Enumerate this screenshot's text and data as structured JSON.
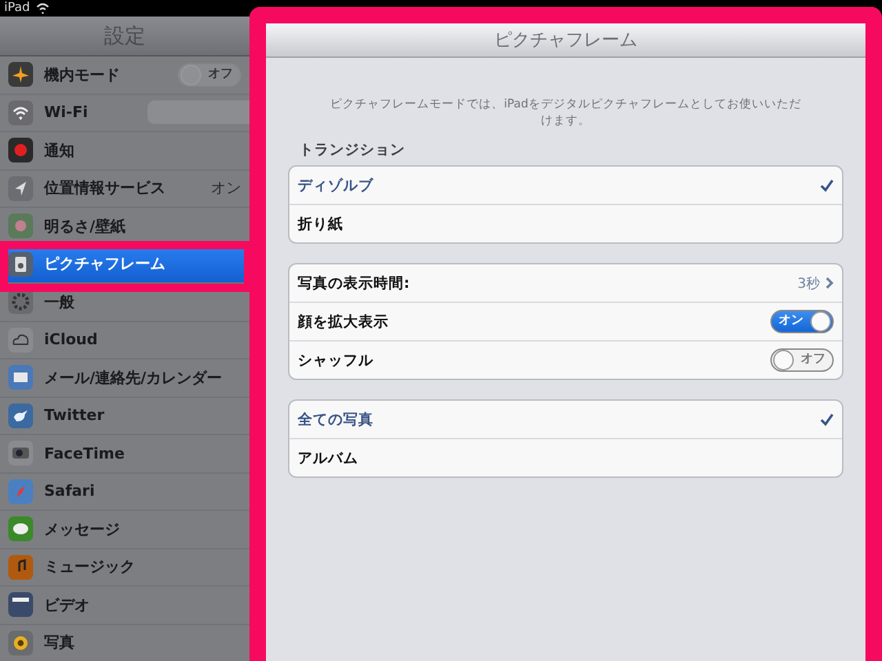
{
  "status_bar": {
    "device": "iPad"
  },
  "sidebar": {
    "title": "設定",
    "items": [
      {
        "label": "機内モード",
        "kind": "toggle",
        "on": false,
        "toggle_text": "オフ",
        "selected": false
      },
      {
        "label": "Wi-Fi",
        "kind": "field",
        "selected": false
      },
      {
        "label": "通知",
        "kind": "plain",
        "selected": false
      },
      {
        "label": "位置情報サービス",
        "kind": "value",
        "value": "オン",
        "selected": false
      },
      {
        "label": "明るさ/壁紙",
        "kind": "plain",
        "selected": false
      },
      {
        "label": "ピクチャフレーム",
        "kind": "plain",
        "selected": true
      },
      {
        "label": "一般",
        "kind": "plain",
        "selected": false
      },
      {
        "label": "iCloud",
        "kind": "plain",
        "selected": false
      },
      {
        "label": "メール/連絡先/カレンダー",
        "kind": "plain",
        "selected": false
      },
      {
        "label": "Twitter",
        "kind": "plain",
        "selected": false
      },
      {
        "label": "FaceTime",
        "kind": "plain",
        "selected": false
      },
      {
        "label": "Safari",
        "kind": "plain",
        "selected": false
      },
      {
        "label": "メッセージ",
        "kind": "plain",
        "selected": false
      },
      {
        "label": "ミュージック",
        "kind": "plain",
        "selected": false
      },
      {
        "label": "ビデオ",
        "kind": "plain",
        "selected": false
      },
      {
        "label": "写真",
        "kind": "plain",
        "selected": false
      }
    ]
  },
  "detail": {
    "title": "ピクチャフレーム",
    "description": "ピクチャフレームモードでは、iPadをデジタルピクチャフレームとしてお使いいただけます。",
    "groups": [
      {
        "header": "トランジション",
        "rows": [
          {
            "kind": "check",
            "label": "ディゾルブ",
            "selected": true
          },
          {
            "kind": "check",
            "label": "折り紙",
            "selected": false
          }
        ]
      },
      {
        "rows": [
          {
            "kind": "link",
            "label": "写真の表示時間:",
            "value": "3秒"
          },
          {
            "kind": "toggle",
            "label": "顔を拡大表示",
            "on": true,
            "toggle_text": "オン"
          },
          {
            "kind": "toggle",
            "label": "シャッフル",
            "on": false,
            "toggle_text": "オフ"
          }
        ]
      },
      {
        "rows": [
          {
            "kind": "check",
            "label": "全ての写真",
            "selected": true
          },
          {
            "kind": "check",
            "label": "アルバム",
            "selected": false
          }
        ]
      }
    ]
  }
}
